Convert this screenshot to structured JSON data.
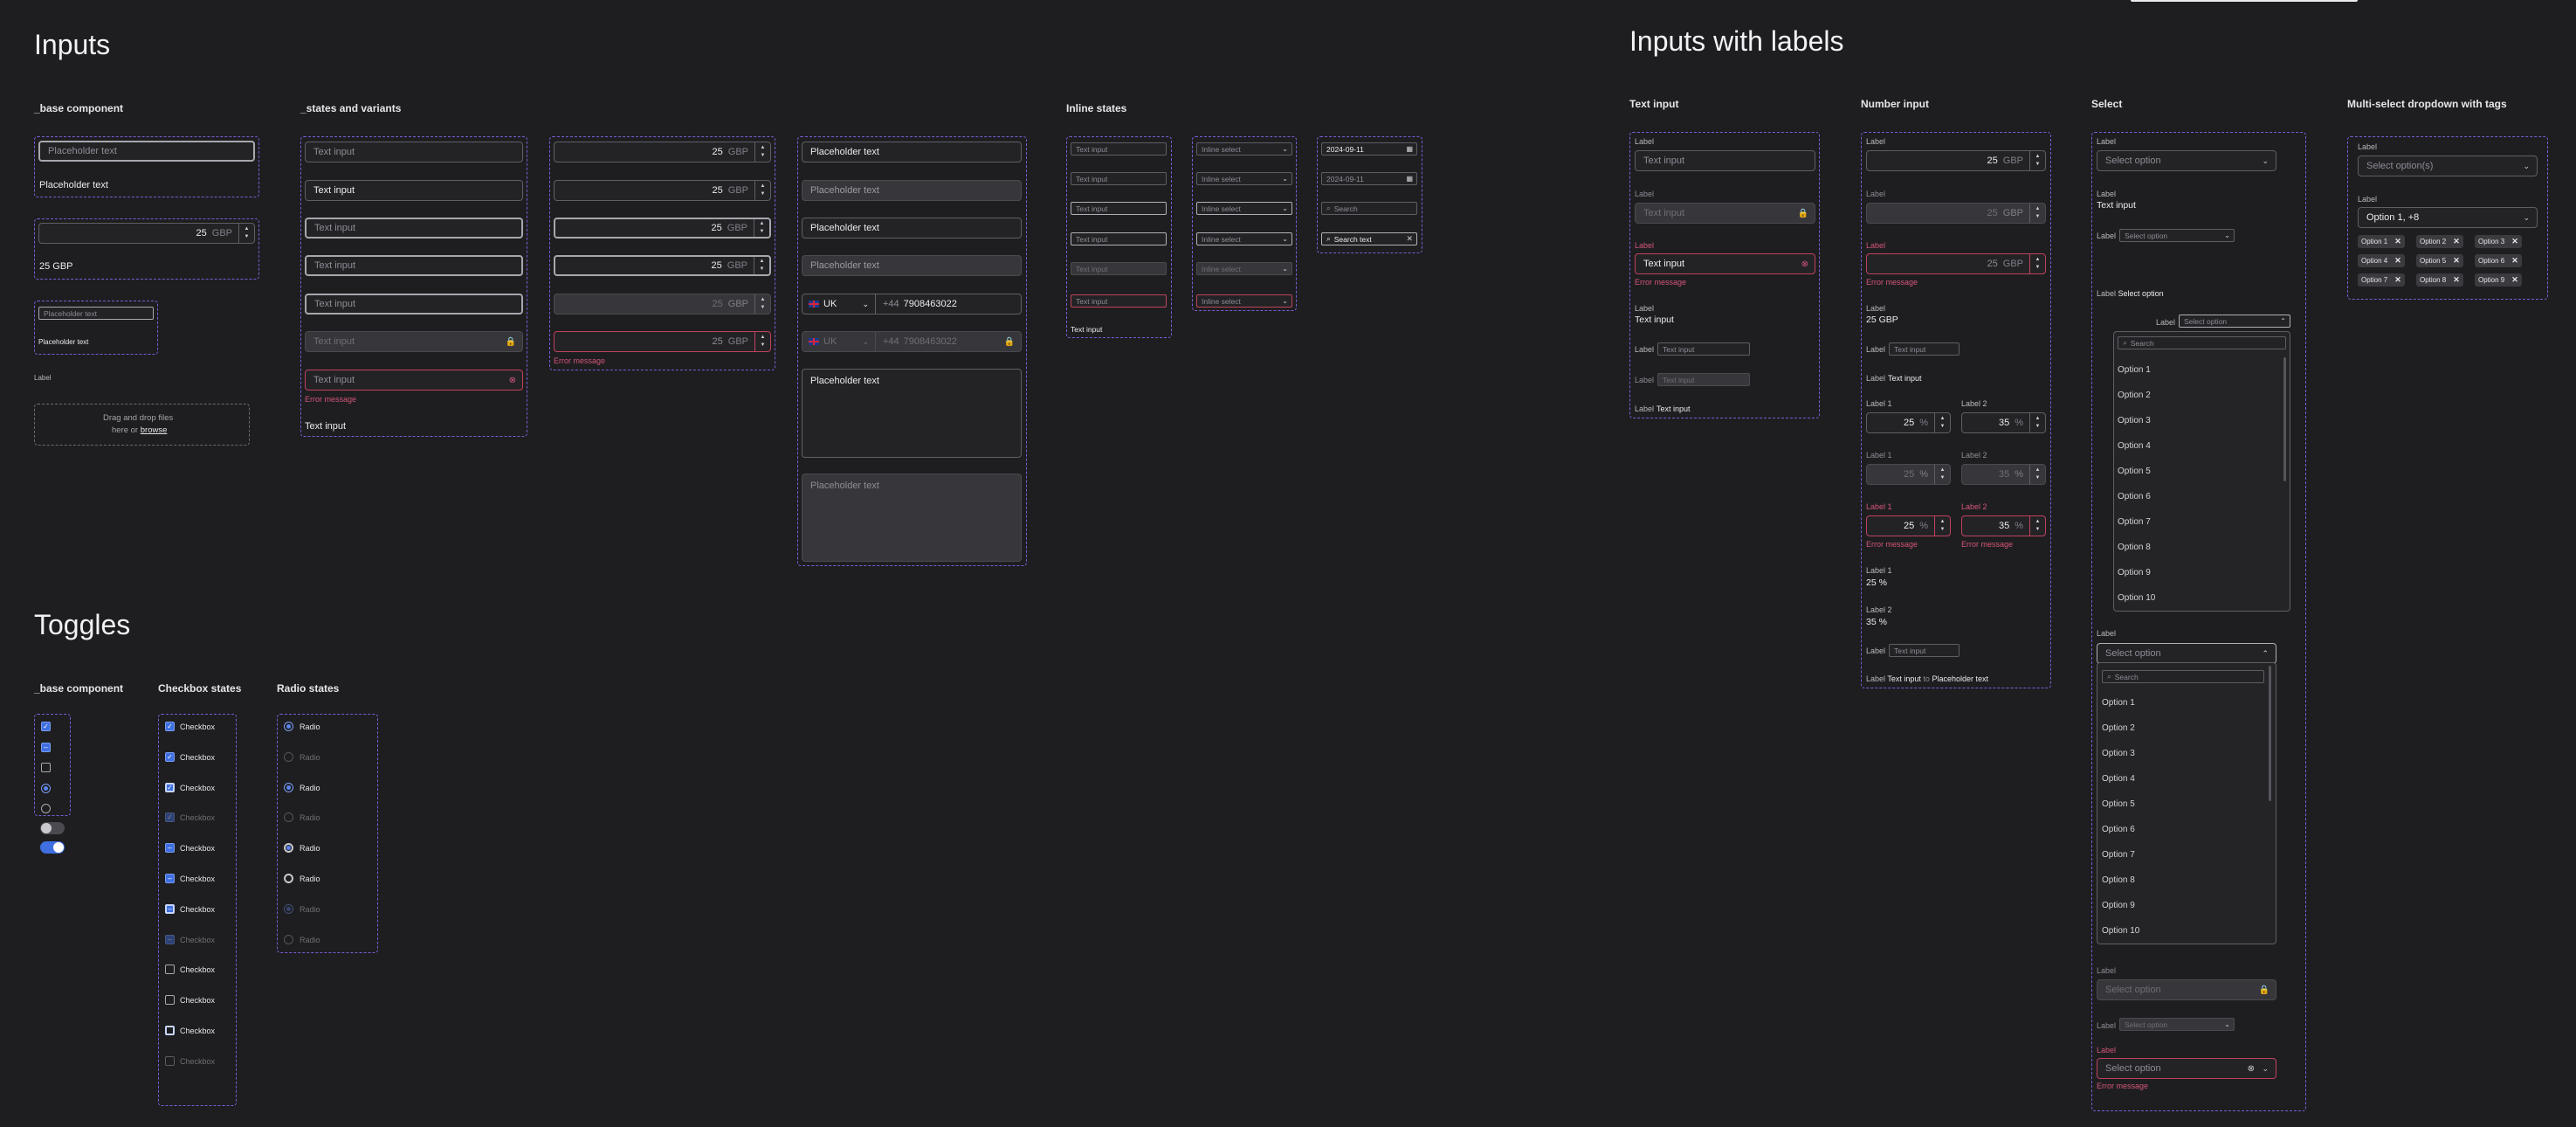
{
  "sections": {
    "inputs": "Inputs",
    "inputs_labels": "Inputs with labels",
    "toggles": "Toggles"
  },
  "headers": {
    "base": "_base component",
    "states": "_states and variants",
    "inline": "Inline states",
    "text_input": "Text input",
    "number_input": "Number input",
    "select": "Select",
    "multi": "Multi-select dropdown with tags",
    "toggle_base": "_base component",
    "checkbox_states": "Checkbox states",
    "radio_states": "Radio states"
  },
  "t": {
    "placeholder": "Placeholder text",
    "text_input": "Text input",
    "num": "25",
    "gbp": "GBP",
    "gbp_value": "25 GBP",
    "label": "Label",
    "drop_line1": "Drag and drop files",
    "drop_line2": "here or",
    "browse": "browse",
    "error": "Error message",
    "country": "UK",
    "phone_prefix": "+44",
    "phone_number": "7908463022",
    "inline_select": "Inline select",
    "date": "2024-09-11",
    "search": "Search",
    "search_text": "Search text",
    "label1": "Label 1",
    "label2": "Label 2",
    "pct25": "25",
    "pct35": "35",
    "pct": "%",
    "pct25v": "25 %",
    "pct35v": "35 %",
    "to": "to",
    "select_option": "Select option",
    "select_options": "Select option(s)",
    "select_option_val": "Select option",
    "multi_value": "Option 1, +8",
    "checkbox": "Checkbox",
    "radio": "Radio"
  },
  "options": [
    "Option 1",
    "Option 2",
    "Option 3",
    "Option 4",
    "Option 5",
    "Option 6",
    "Option 7",
    "Option 8",
    "Option 9",
    "Option 10"
  ],
  "tags": [
    "Option 1",
    "Option 2",
    "Option 3",
    "Option 4",
    "Option 5",
    "Option 6",
    "Option 7",
    "Option 8",
    "Option 9"
  ],
  "colors": {
    "accent": "#3f6fe0",
    "error": "#c0415d",
    "dashed": "#7b5cd6",
    "bg": "#1e1e20"
  }
}
